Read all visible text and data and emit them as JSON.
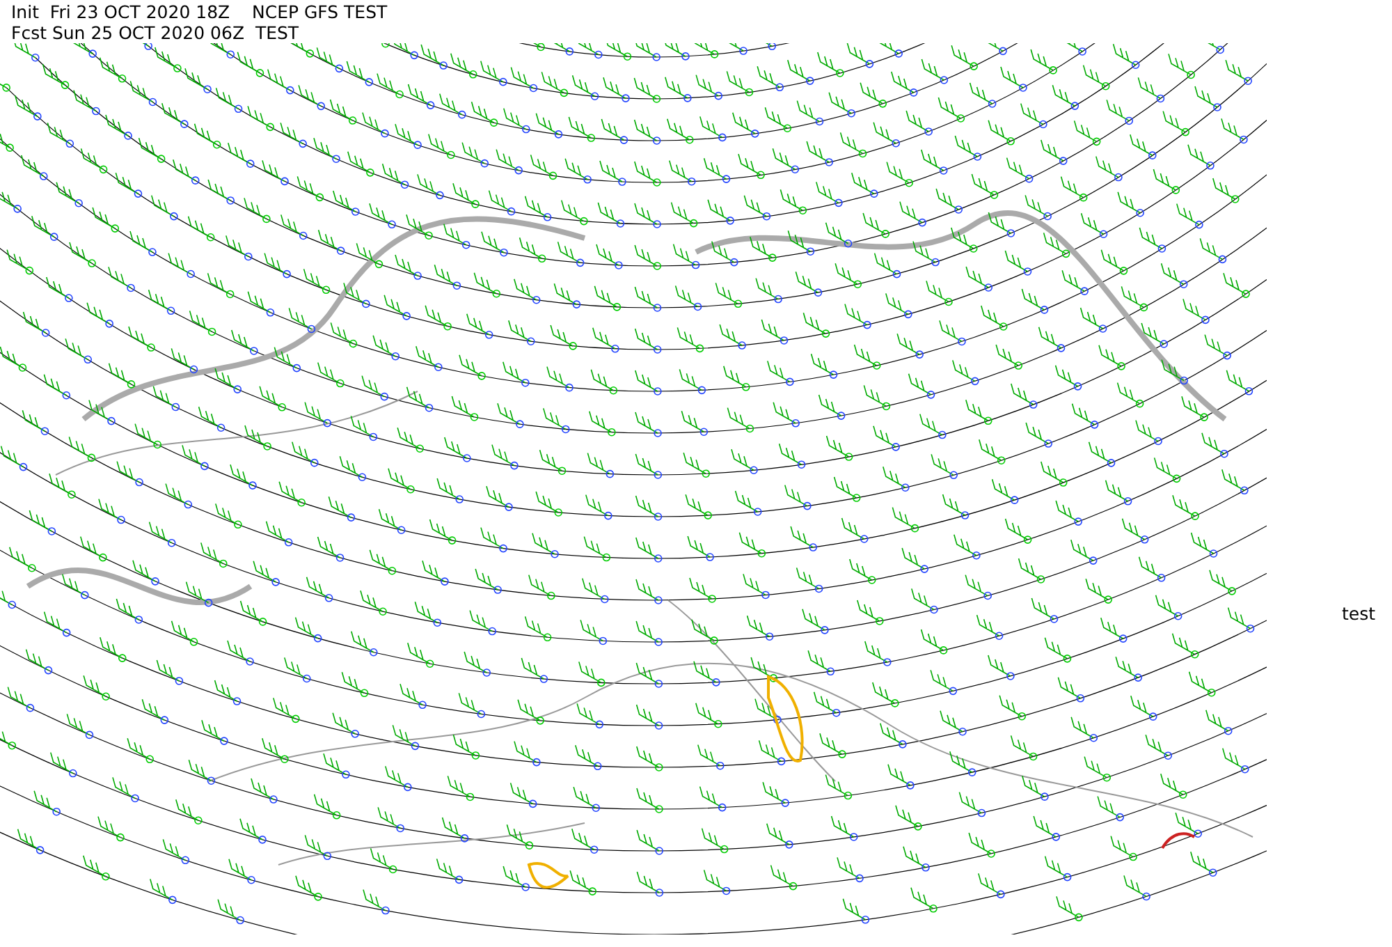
{
  "header": {
    "lines": [
      "Init  Fri 23 OCT 2020 18Z    NCEP GFS TEST",
      "Fcst Sun 25 OCT 2020 06Z  TEST"
    ]
  },
  "side_label": "test"
}
